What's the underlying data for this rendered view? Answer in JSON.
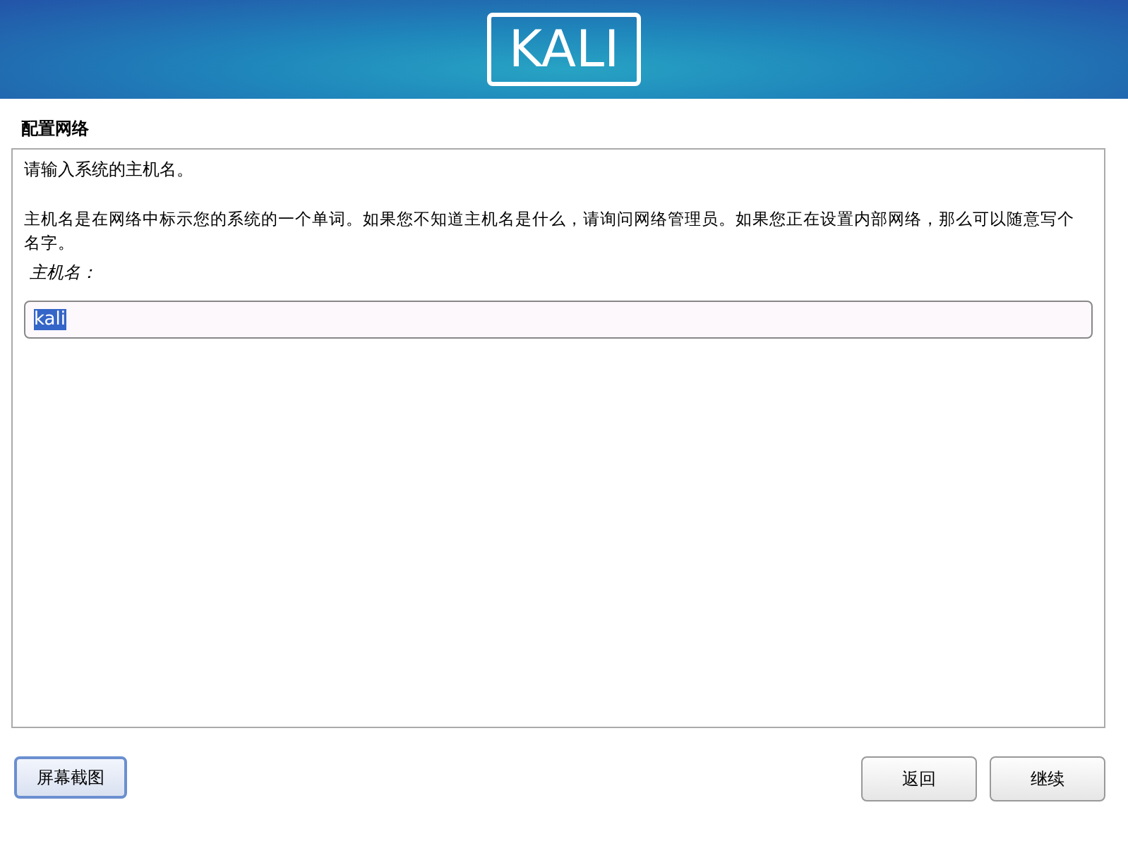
{
  "header": {
    "logo": "KALI"
  },
  "title": "配置网络",
  "panel": {
    "prompt": "请输入系统的主机名。",
    "description": "主机名是在网络中标示您的系统的一个单词。如果您不知道主机名是什么，请询问网络管理员。如果您正在设置内部网络，那么可以随意写个名字。",
    "field_label": "主机名：",
    "field": {
      "value": "kali",
      "text_selected": true
    }
  },
  "left_buttons": [
    {
      "label": "屏幕截图",
      "focused": true
    }
  ],
  "right_buttons": [
    {
      "label": "返回",
      "focused": false
    },
    {
      "label": "继续",
      "focused": false
    }
  ]
}
